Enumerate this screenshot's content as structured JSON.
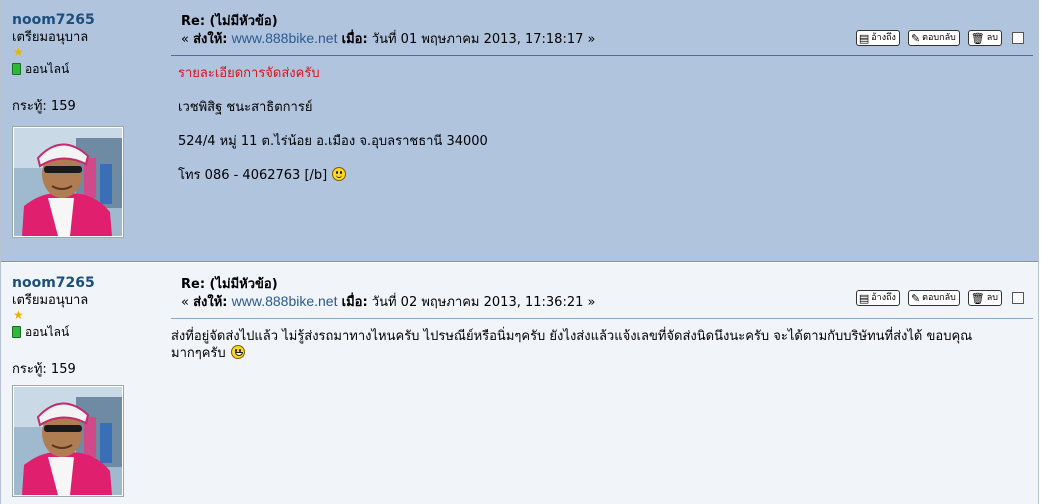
{
  "posts": [
    {
      "poster": {
        "username": "noom7265",
        "rank": "เตรียมอนุบาล",
        "online_label": "ออนไลน์",
        "post_count": "กระทู้: 159"
      },
      "subject": "Re: (ไม่มีหัวข้อ)",
      "meta": {
        "prefix": "« ",
        "sent_to_label": "ส่งให้:",
        "site": "www.888bike.net",
        "when_label": "เมื่อ:",
        "datetime": "วันที่ 01 พฤษภาคม 2013, 17:18:17",
        "suffix": " »"
      },
      "buttons": {
        "quote": "อ้างถึง",
        "reply": "ตอบกลับ",
        "delete": "ลบ"
      },
      "body": {
        "line1": "รายละเอียดการจัดส่งครับ",
        "line2": "เวชพิสิฐ ชนะสาธิตการย์",
        "line3": "524/4 หมู่ 11 ต.ไร่น้อย อ.เมือง จ.อุบลราชธานี 34000",
        "line4": "โทร 086 - 4062763 [/b]"
      }
    },
    {
      "poster": {
        "username": "noom7265",
        "rank": "เตรียมอนุบาล",
        "online_label": "ออนไลน์",
        "post_count": "กระทู้: 159"
      },
      "subject": "Re: (ไม่มีหัวข้อ)",
      "meta": {
        "prefix": "« ",
        "sent_to_label": "ส่งให้:",
        "site": "www.888bike.net",
        "when_label": "เมื่อ:",
        "datetime": "วันที่ 02 พฤษภาคม 2013, 11:36:21",
        "suffix": " »"
      },
      "buttons": {
        "quote": "อ้างถึง",
        "reply": "ตอบกลับ",
        "delete": "ลบ"
      },
      "body": {
        "line1": "ส่งที่อยู่จัดส่งไปแล้ว ไม่รู้ส่งรถมาทางไหนครับ ไปรษณีย์หรือนิ่มๆครับ ยังไงส่งแล้วแจ้งเลขที่จัดส่งนิดนึงนะครับ จะได้ตามกับบริษัทนที่ส่งได้ ขอบคุณ",
        "line2": "มากๆครับ"
      }
    }
  ],
  "colors": {
    "post1_bg": "#b0c4de",
    "post2_bg": "#f1f4f8",
    "username": "#1d4e7c",
    "link": "#2b5a91",
    "highlight_red": "#d6161f"
  },
  "icons": {
    "rank": "star-icon",
    "online": "online-indicator-icon",
    "quote": "quote-icon",
    "reply": "reply-icon",
    "delete": "trash-icon",
    "emoticon1": "smiley-icon",
    "emoticon2": "grin-icon"
  }
}
